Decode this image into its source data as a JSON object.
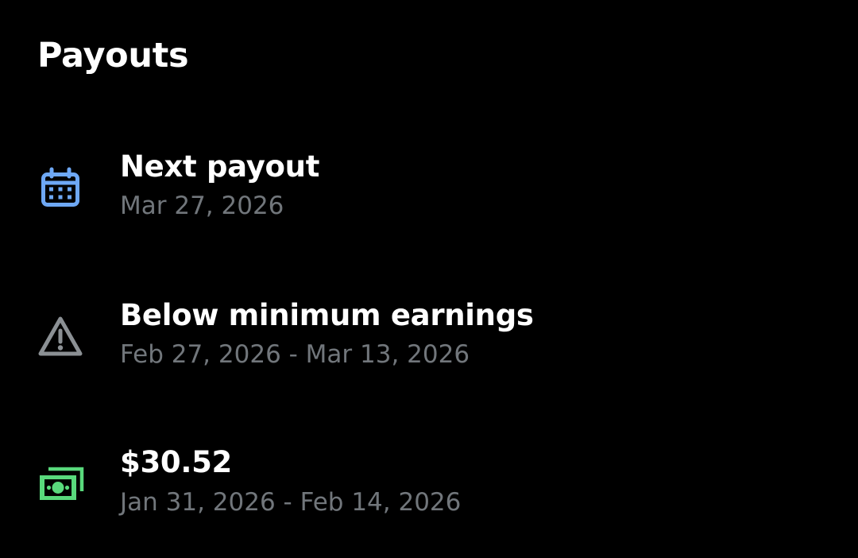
{
  "colors": {
    "background": "#000000",
    "title_text": "#ffffff",
    "subtitle_text": "#71767b",
    "calendar_icon": "#6ea8f5",
    "warning_icon": "#8b9094",
    "money_icon": "#59d97c"
  },
  "header": {
    "title": "Payouts"
  },
  "payouts": [
    {
      "icon": "calendar-icon",
      "title": "Next payout",
      "subtitle": "Mar 27, 2026"
    },
    {
      "icon": "warning-icon",
      "title": "Below minimum earnings",
      "subtitle": "Feb 27, 2026 - Mar 13, 2026"
    },
    {
      "icon": "money-icon",
      "title": "$30.52",
      "subtitle": "Jan 31, 2026 - Feb 14, 2026"
    }
  ]
}
